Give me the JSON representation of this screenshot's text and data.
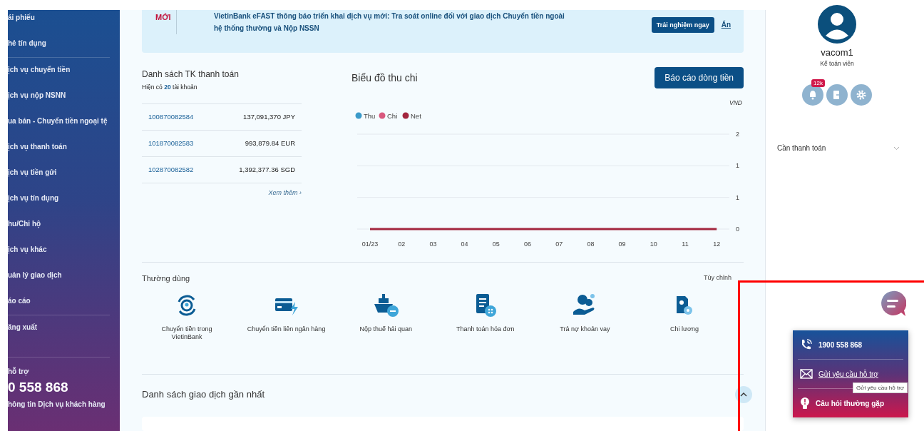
{
  "sidebar": {
    "sections": [
      [
        "ái phiếu",
        "hẻ tín dụng"
      ],
      [
        "ịch vụ chuyển tiền",
        "ịch vụ nộp NSNN",
        "ua bán - Chuyển tiền ngoại tệ",
        "ịch vụ thanh toán",
        "ịch vụ tiền gửi",
        "ịch vụ tín dụng",
        "hu/Chi hộ",
        "ịch vụ khác",
        "uản lý giao dịch",
        "áo cáo"
      ],
      [
        "ăng xuất"
      ]
    ],
    "support": {
      "title": "hỗ trợ",
      "phone": "0 558 868",
      "link": "hông tin Dịch vụ khách hàng"
    }
  },
  "banner": {
    "badge": "MỚI",
    "message": "VietinBank eFAST thông báo triển khai dịch vụ mới: Tra soát online đối với giao dịch Chuyển tiền ngoài hệ thống thường và Nộp NSSN",
    "action": "Trải nghiệm ngay",
    "dismiss": "Ẩn"
  },
  "accounts": {
    "title": "Danh sách TK thanh toán",
    "count_text": "Hiện có **20** tài khoản",
    "rows": [
      {
        "number": "100870082584",
        "balance": "137,091,370 JPY"
      },
      {
        "number": "101870082583",
        "balance": "993,879.84 EUR"
      },
      {
        "number": "102870082582",
        "balance": "1,392,377.36 SGD"
      }
    ],
    "more": "Xem thêm ›"
  },
  "cashflow": {
    "title": "Biểu đồ thu chi",
    "report_button": "Báo cáo dòng tiền",
    "unit": "VND",
    "chart_data": {
      "type": "line",
      "categories": [
        "01/23",
        "02",
        "03",
        "04",
        "05",
        "06",
        "07",
        "08",
        "09",
        "10",
        "11",
        "12"
      ],
      "series": [
        {
          "name": "Thu",
          "color": "#3b9ac9",
          "values": [
            null,
            null,
            null,
            null,
            null,
            null,
            null,
            null,
            null,
            null,
            null,
            null
          ]
        },
        {
          "name": "Chi",
          "color": "#d9587e",
          "values": [
            null,
            null,
            null,
            null,
            null,
            null,
            null,
            null,
            null,
            null,
            null,
            null
          ]
        },
        {
          "name": "Net",
          "color": "#a3263e",
          "values": [
            0,
            0,
            0,
            0,
            0,
            0,
            0,
            0,
            0,
            0,
            0,
            0
          ]
        }
      ],
      "legend": "top",
      "ylim": [
        0,
        2
      ],
      "yticks": [
        0,
        {
          "value": 0.667,
          "label": "1"
        },
        {
          "value": 1.333,
          "label": "1"
        },
        2
      ]
    }
  },
  "favorites": {
    "title": "Thường dùng",
    "customize": "Tùy chỉnh",
    "items": [
      {
        "kind": "internal",
        "label": "Chuyển tiền trong VietinBank"
      },
      {
        "kind": "interbank",
        "label": "Chuyển tiền liên ngân hàng"
      },
      {
        "kind": "customs",
        "label": "Nộp thuế hải quan"
      },
      {
        "kind": "bill",
        "label": "Thanh toán hóa đơn"
      },
      {
        "kind": "loan",
        "label": "Trả nợ khoản vay"
      },
      {
        "kind": "payroll",
        "label": "Chi lương"
      }
    ]
  },
  "recent": {
    "title": "Danh sách giao dịch gần nhất",
    "expanded": true
  },
  "profile": {
    "name": "vacom1",
    "role": "Kế toán viên",
    "notification_count": "12k",
    "filter": "Cần thanh toán"
  },
  "support_popup": {
    "items": [
      {
        "kind": "phone",
        "label": "1900 558 868",
        "link": false
      },
      {
        "kind": "mail",
        "label": "Gửi yêu cầu hỗ trợ",
        "link": true
      },
      {
        "kind": "faq",
        "label": "Câu hỏi thường gặp",
        "link": false
      }
    ],
    "tooltip": "Gửi yêu cầu hỗ trợ"
  }
}
